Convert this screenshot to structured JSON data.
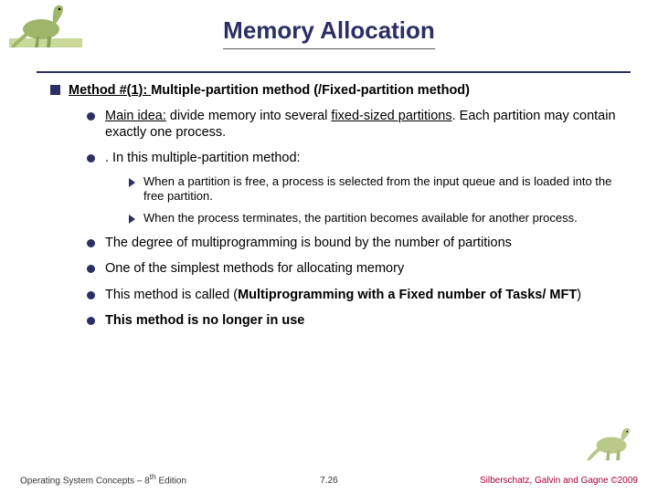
{
  "title": "Memory Allocation",
  "headline": {
    "method": "Method #(1): ",
    "rest": "Multiple-partition method (/Fixed-partition method)"
  },
  "main_idea": {
    "prefix": "Main idea:",
    "mid": " divide memory into several ",
    "em": "fixed-sized partitions",
    "tail": ". Each partition may contain exactly one process."
  },
  "in_method": ". In this multiple-partition method:",
  "sub1": "When a partition is free, a process is selected from the input queue and is loaded into the free partition.",
  "sub2": "When the process terminates, the partition becomes available for another process.",
  "degree": "The degree of multiprogramming is bound by the number of partitions",
  "simplest": "One of the simplest methods for allocating memory",
  "called": {
    "pre": "This method is called  (",
    "em": "Multiprogramming with a Fixed number of Tasks/ MFT",
    "post": ")"
  },
  "nouse": "This method is no longer in use",
  "footer": {
    "left": "Operating System Concepts – 8",
    "left_sup": "th",
    "left_tail": " Edition",
    "mid": "7.26",
    "right": "Silberschatz, Galvin and Gagne ©2009"
  }
}
